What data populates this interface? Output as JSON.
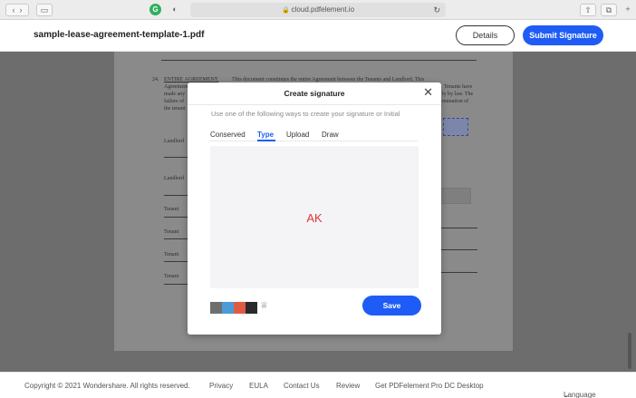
{
  "browser": {
    "url": "cloud.pdfelement.io",
    "extension_letter": "G",
    "icons": [
      "back-icon",
      "forward-icon",
      "sidebar-icon",
      "grammarly-icon",
      "shield-icon",
      "lock-icon",
      "reload-icon",
      "share-icon",
      "tabs-icon",
      "new-tab-icon"
    ]
  },
  "header": {
    "doc_title": "sample-lease-agreement-template-1.pdf",
    "details_label": "Details",
    "submit_label": "Submit Signature"
  },
  "document": {
    "para_number": "24.",
    "para_heading": "ENTIRE AGREEMENT.",
    "line1": "This document constitutes the entire Agreement between the Tenants and Landlord. This",
    "line2": "Agreement",
    "line2_tail": "Tenants have",
    "line3": "made any",
    "line3_tail": "ly by law. The",
    "line4": "failure of",
    "line4_tail": "termination of",
    "line5": "the tenant",
    "rows": [
      "Landlord",
      "Landlord",
      "Tenant",
      "Tenant",
      "Tenant",
      "Tenant"
    ]
  },
  "modal": {
    "title": "Create signature",
    "subtitle": "Use one of the following ways to create your signature or Initial",
    "tabs": [
      "Conserved",
      "Type",
      "Upload",
      "Draw"
    ],
    "active_tab": "Type",
    "signature_text": "AK",
    "signature_color": "#d93a3a",
    "swatches": [
      "#6e6e6e",
      "#4a9bd8",
      "#e05b44",
      "#2a2a2a"
    ],
    "save_label": "Save"
  },
  "footer": {
    "copyright": "Copyright © 2021 Wondershare. All rights reserved.",
    "links": [
      "Privacy",
      "EULA",
      "Contact Us",
      "Review",
      "Get PDFelement Pro DC Desktop"
    ],
    "language_label": "Language"
  }
}
